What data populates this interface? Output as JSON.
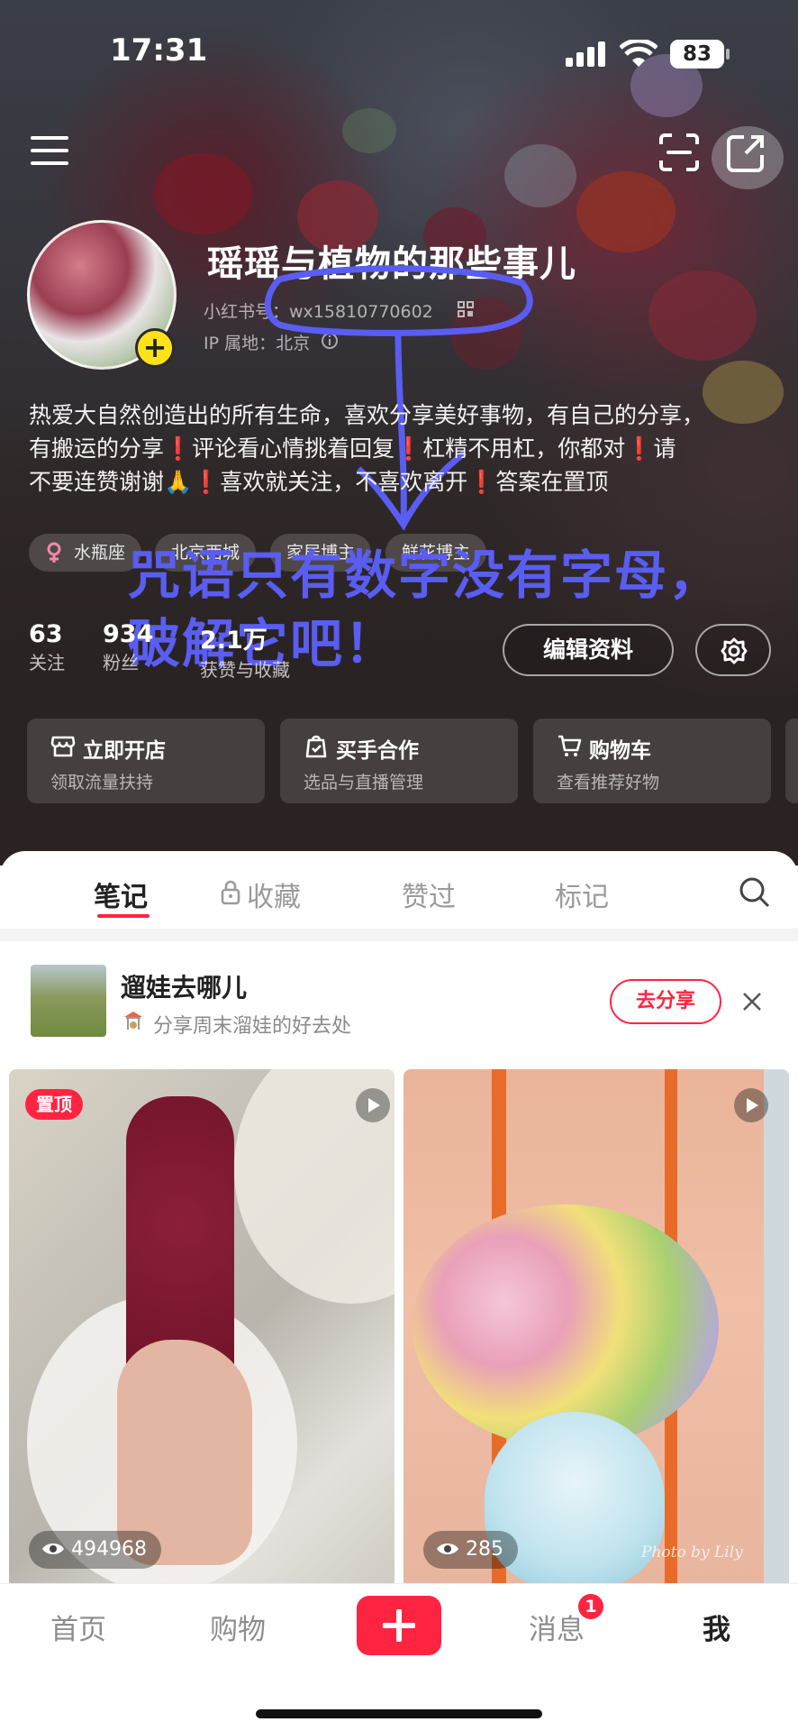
{
  "status_bar": {
    "time": "17:31",
    "battery": "83"
  },
  "profile": {
    "name": "瑶瑶与植物的那些事儿",
    "account_label": "小红书号：",
    "account_id": "wx15810770602",
    "ip_label": "IP 属地：北京",
    "bio_lines": [
      "热爱大自然创造出的所有生命，喜欢分享美好事物，有自己的分享，",
      "有搬运的分享❗️评论看心情挑着回复❗️杠精不用杠，你都对❗️请",
      "不要连赞谢谢🙏❗️喜欢就关注，不喜欢离开❗️答案在置顶"
    ],
    "tags": [
      "水瓶座",
      "北京西城",
      "家居博主",
      "鲜花博主"
    ],
    "stats": [
      {
        "value": "63",
        "label": "关注"
      },
      {
        "value": "934",
        "label": "粉丝"
      },
      {
        "value": "2.1万",
        "label": "获赞与收藏"
      }
    ],
    "edit_button": "编辑资料"
  },
  "annotation_lines": [
    "咒语只有数字没有字母，",
    "破解它吧！"
  ],
  "service_cards": [
    {
      "title": "立即开店",
      "subtitle": "领取流量扶持",
      "icon": "shop-icon"
    },
    {
      "title": "买手合作",
      "subtitle": "选品与直播管理",
      "icon": "bag-icon"
    },
    {
      "title": "购物车",
      "subtitle": "查看推荐好物",
      "icon": "cart-icon"
    }
  ],
  "tabs": [
    "笔记",
    "收藏",
    "赞过",
    "标记"
  ],
  "banner": {
    "title": "遛娃去哪儿",
    "subtitle": "分享周末溜娃的好去处",
    "button": "去分享"
  },
  "feed": [
    {
      "pinned_label": "置顶",
      "views": "494968"
    },
    {
      "views": "285",
      "watermark": "Photo by Lily"
    }
  ],
  "bottom_nav": [
    "首页",
    "购物",
    "消息",
    "我"
  ],
  "message_badge": "1",
  "colors": {
    "accent": "#ff2442",
    "annotation": "#5a5df2"
  }
}
